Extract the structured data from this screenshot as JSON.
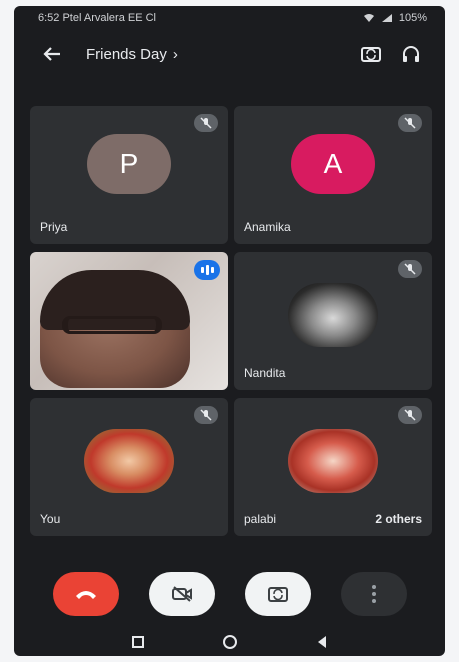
{
  "status_bar": {
    "left_text": "6:52 Ptel Arvalera EE Cl",
    "right_text": "105%"
  },
  "app_bar": {
    "title": "Friends Day",
    "chevron": "›"
  },
  "participants": [
    {
      "name": "Priya",
      "initial": "P",
      "avatar_color": "#7e6c68",
      "muted": true,
      "kind": "initial"
    },
    {
      "name": "Anamika",
      "initial": "A",
      "avatar_color": "#d81b60",
      "muted": true,
      "kind": "initial"
    },
    {
      "name": "",
      "kind": "video",
      "speaking": true
    },
    {
      "name": "Nandita",
      "kind": "photo",
      "muted": true
    },
    {
      "name": "You",
      "kind": "photo",
      "muted": true
    },
    {
      "name": "palabi",
      "extra": "2 others",
      "kind": "photo",
      "muted": true
    }
  ],
  "colors": {
    "end_call": "#ea4335",
    "speaking_badge": "#1a73e8",
    "tile_bg": "#2e3033",
    "screen_bg": "#1b1c1f"
  },
  "icons": [
    "back-arrow-icon",
    "switch-camera-icon",
    "audio-output-icon",
    "mic-off-icon",
    "speaking-indicator-icon",
    "end-call-icon",
    "camera-off-icon",
    "flip-camera-icon",
    "more-options-icon",
    "recent-apps-icon",
    "home-icon",
    "nav-back-icon"
  ]
}
